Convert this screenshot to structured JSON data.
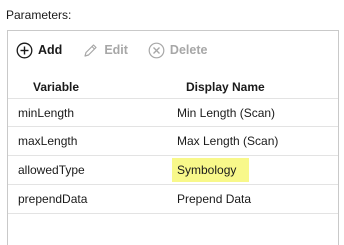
{
  "section": {
    "label": "Parameters:"
  },
  "toolbar": {
    "add_label": "Add",
    "edit_label": "Edit",
    "delete_label": "Delete",
    "icons": {
      "add": "plus-circle-icon",
      "edit": "pencil-icon",
      "delete": "x-circle-icon"
    }
  },
  "table": {
    "headers": {
      "variable": "Variable",
      "display_name": "Display Name"
    },
    "rows": [
      {
        "variable": "minLength",
        "display_name": "Min Length (Scan)"
      },
      {
        "variable": "maxLength",
        "display_name": "Max Length (Scan)"
      },
      {
        "variable": "allowedType",
        "display_name": "Symbology",
        "highlighted": true
      },
      {
        "variable": "prependData",
        "display_name": "Prepend Data"
      }
    ]
  },
  "colors": {
    "highlight": "#f8f88a",
    "disabled_text": "#a7a7a7",
    "border": "#c9c9c9"
  }
}
